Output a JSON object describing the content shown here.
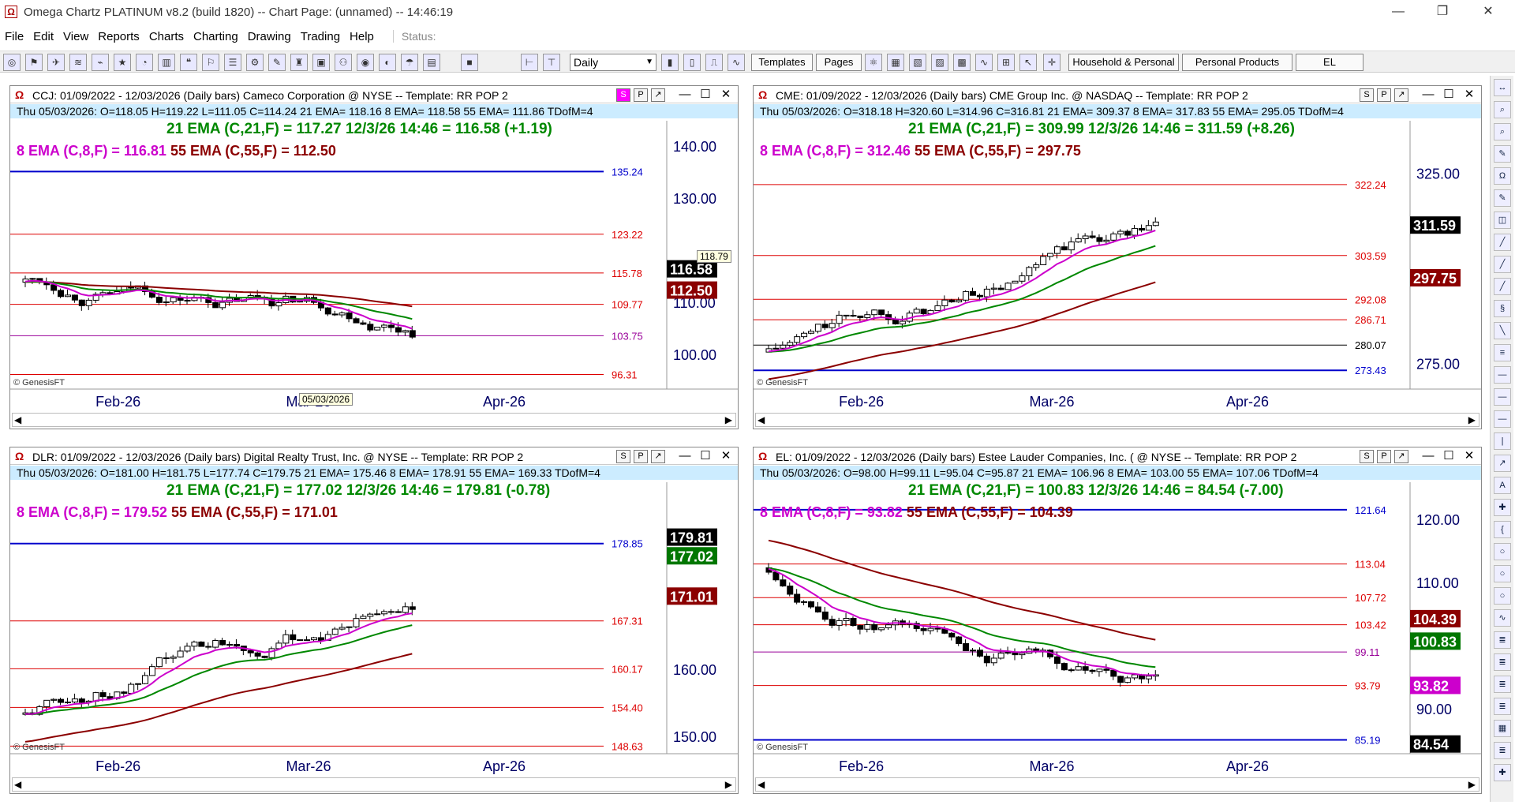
{
  "app": {
    "title": "Omega Chartz PLATINUM v8.2 (build 1820)  --  Chart Page: (unnamed) -- 14:46:19",
    "minimize": "—",
    "restore": "❐",
    "close": "✕"
  },
  "menu": {
    "items": [
      "File",
      "Edit",
      "View",
      "Reports",
      "Charts",
      "Charting",
      "Drawing",
      "Trading",
      "Help"
    ],
    "status_label": "Status:"
  },
  "toolbar": {
    "period": "Daily",
    "buttons": [
      "Templates",
      "Pages",
      "Household & Personal",
      "Personal Products",
      "EL"
    ]
  },
  "charts": [
    {
      "id": "ccj",
      "title": "CCJ:  01/09/2022 - 12/03/2026  (Daily bars)   Cameco Corporation @ NYSE  --  Template: RR POP 2",
      "ohlc": "Thu   05/03/2026:   O=118.05   H=119.22   L=111.05   C=114.24   21 EMA= 118.16   8 EMA= 118.58   55 EMA= 111.86   TDofM=4",
      "ema21_text": "21 EMA (C,21,F) = 117.27  12/3/26 14:46 = 116.58 (+1.19)",
      "ema8_text": "8 EMA (C,8,F) = 116.81",
      "ema55_text": "55 EMA (C,55,F) = 112.50",
      "buttons": [
        "S",
        "P",
        "↗"
      ],
      "xlabels": [
        "Feb-26",
        "Mar-26",
        "Apr-26"
      ],
      "ylabels": [
        "140.00",
        "130.00",
        "110.00",
        "100.00"
      ],
      "hlines": [
        {
          "v": 135.24,
          "label": "135.24",
          "color": "#0000cc"
        },
        {
          "v": 123.22,
          "label": "123.22",
          "color": "#dd0000"
        },
        {
          "v": 115.78,
          "label": "115.78",
          "color": "#dd0000"
        },
        {
          "v": 109.77,
          "label": "109.77",
          "color": "#dd0000"
        },
        {
          "v": 103.75,
          "label": "103.75",
          "color": "#990099"
        },
        {
          "v": 96.31,
          "label": "96.31",
          "color": "#dd0000"
        }
      ],
      "badges": [
        {
          "v": 116.58,
          "label": "116.58",
          "bg": "#000000"
        },
        {
          "v": 112.5,
          "label": "112.50",
          "bg": "#8b0000"
        }
      ],
      "tooltip_price": "118.79",
      "tooltip_date": "05/03/2026",
      "watermark": "© GenesisFT"
    },
    {
      "id": "cme",
      "title": "CME:  01/09/2022 - 12/03/2026  (Daily bars)   CME Group Inc. @ NASDAQ  --  Template: RR POP 2",
      "ohlc": "Thu   05/03/2026:   O=318.18   H=320.60   L=314.96   C=316.81   21 EMA= 309.37   8 EMA= 317.83   55 EMA= 295.05   TDofM=4",
      "ema21_text": "21 EMA (C,21,F) = 309.99  12/3/26 14:46 = 311.59 (+8.26)",
      "ema8_text": "8 EMA (C,8,F) = 312.46",
      "ema55_text": "55 EMA (C,55,F) = 297.75",
      "buttons": [
        "S",
        "P",
        "↗"
      ],
      "xlabels": [
        "Feb-26",
        "Mar-26",
        "Apr-26"
      ],
      "ylabels": [
        "325.00",
        "275.00"
      ],
      "hlines": [
        {
          "v": 322.24,
          "label": "322.24",
          "color": "#dd0000"
        },
        {
          "v": 303.59,
          "label": "303.59",
          "color": "#dd0000"
        },
        {
          "v": 292.08,
          "label": "292.08",
          "color": "#dd0000"
        },
        {
          "v": 286.71,
          "label": "286.71",
          "color": "#dd0000"
        },
        {
          "v": 280.07,
          "label": "280.07",
          "color": "#000000"
        },
        {
          "v": 273.43,
          "label": "273.43",
          "color": "#0000cc"
        }
      ],
      "badges": [
        {
          "v": 311.59,
          "label": "311.59",
          "bg": "#000000"
        },
        {
          "v": 297.75,
          "label": "297.75",
          "bg": "#8b0000"
        }
      ],
      "watermark": "© GenesisFT"
    },
    {
      "id": "dlr",
      "title": "DLR:  01/09/2022 - 12/03/2026  (Daily bars)   Digital Realty Trust, Inc. @ NYSE  --  Template: RR POP 2",
      "ohlc": "Thu   05/03/2026:   O=181.00   H=181.75   L=177.74   C=179.75   21 EMA= 175.46   8 EMA= 178.91   55 EMA= 169.33   TDofM=4",
      "ema21_text": "21 EMA (C,21,F) = 177.02  12/3/26 14:46 = 179.81 (-0.78)",
      "ema8_text": "8 EMA (C,8,F) = 179.52",
      "ema55_text": "55 EMA (C,55,F) = 171.01",
      "buttons": [
        "S",
        "P",
        "↗"
      ],
      "xlabels": [
        "Feb-26",
        "Mar-26",
        "Apr-26"
      ],
      "ylabels": [
        "160.00",
        "150.00"
      ],
      "hlines": [
        {
          "v": 178.85,
          "label": "178.85",
          "color": "#0000cc"
        },
        {
          "v": 167.31,
          "label": "167.31",
          "color": "#dd0000"
        },
        {
          "v": 160.17,
          "label": "160.17",
          "color": "#dd0000"
        },
        {
          "v": 154.4,
          "label": "154.40",
          "color": "#dd0000"
        },
        {
          "v": 148.63,
          "label": "148.63",
          "color": "#dd0000"
        }
      ],
      "badges": [
        {
          "v": 179.81,
          "label": "179.81",
          "bg": "#000000"
        },
        {
          "v": 177.02,
          "label": "177.02",
          "bg": "#007700"
        },
        {
          "v": 171.01,
          "label": "171.01",
          "bg": "#8b0000"
        }
      ],
      "watermark": "© GenesisFT"
    },
    {
      "id": "el",
      "title": "EL:  01/09/2022 - 12/03/2026  (Daily bars)   Estee Lauder Companies, Inc. ( @ NYSE  --  Template: RR POP 2",
      "ohlc": "Thu   05/03/2026:   O=98.00   H=99.11   L=95.04   C=95.87   21 EMA= 106.96   8 EMA= 103.00   55 EMA= 107.06   TDofM=4",
      "ema21_text": "21 EMA (C,21,F) = 100.83  12/3/26 14:46 = 84.54 (-7.00)",
      "ema8_text": "8 EMA (C,8,F) = 93.82",
      "ema55_text": "55 EMA (C,55,F) = 104.39",
      "buttons": [
        "S",
        "P",
        "↗"
      ],
      "xlabels": [
        "Feb-26",
        "Mar-26",
        "Apr-26"
      ],
      "ylabels": [
        "120.00",
        "110.00",
        "90.00"
      ],
      "hlines": [
        {
          "v": 121.64,
          "label": "121.64",
          "color": "#0000cc"
        },
        {
          "v": 113.04,
          "label": "113.04",
          "color": "#dd0000"
        },
        {
          "v": 107.72,
          "label": "107.72",
          "color": "#dd0000"
        },
        {
          "v": 103.42,
          "label": "103.42",
          "color": "#dd0000"
        },
        {
          "v": 99.11,
          "label": "99.11",
          "color": "#990099"
        },
        {
          "v": 93.79,
          "label": "93.79",
          "color": "#dd0000"
        },
        {
          "v": 85.19,
          "label": "85.19",
          "color": "#0000cc"
        }
      ],
      "badges": [
        {
          "v": 104.39,
          "label": "104.39",
          "bg": "#8b0000"
        },
        {
          "v": 100.83,
          "label": "100.83",
          "bg": "#007700"
        },
        {
          "v": 93.82,
          "label": "93.82",
          "bg": "#cc00cc"
        },
        {
          "v": 84.54,
          "label": "84.54",
          "bg": "#000000"
        }
      ],
      "watermark": "© GenesisFT"
    }
  ]
}
